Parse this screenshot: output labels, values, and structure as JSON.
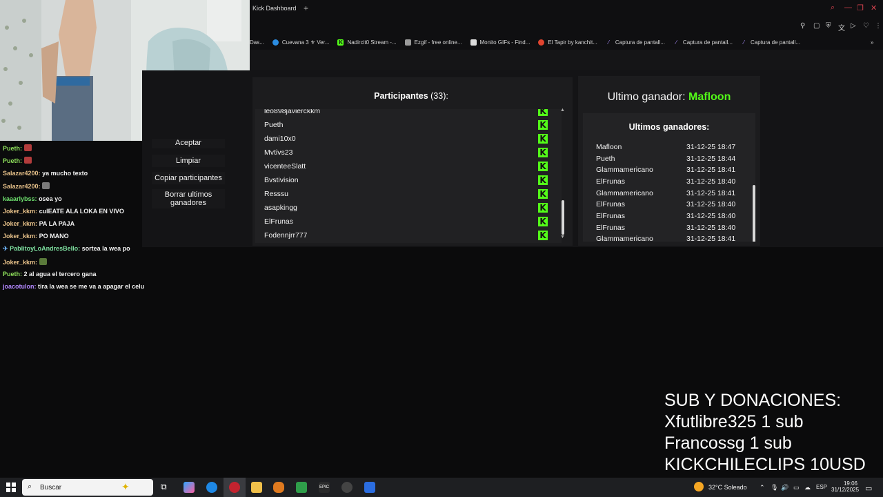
{
  "browser": {
    "tab_title": "Kick Dashboard",
    "new_tab": "+",
    "bookmarks": [
      {
        "label": "Das...",
        "icon": "dashboard-icon",
        "color": "#3b3b3b"
      },
      {
        "label": "Cuevana 3 ⚜ Ver...",
        "icon": "cuevana-icon",
        "color": "#2b8ce0"
      },
      {
        "label": "Nadircit0 Stream -...",
        "icon": "kick-icon",
        "color": "#53fc18"
      },
      {
        "label": "Ezgif - free online...",
        "icon": "ezgif-icon",
        "color": "#9a9a9a"
      },
      {
        "label": "Monito GIFs - Find...",
        "icon": "page-icon",
        "color": "#dddddd"
      },
      {
        "label": "El Tapir by kanchit...",
        "icon": "record-icon",
        "color": "#e0442f"
      },
      {
        "label": "Captura de pantall...",
        "icon": "feather-icon",
        "color": "#a78bfa"
      },
      {
        "label": "Captura de pantall...",
        "icon": "feather-icon",
        "color": "#a78bfa"
      },
      {
        "label": "Captura de pantall...",
        "icon": "feather-icon",
        "color": "#a78bfa"
      }
    ]
  },
  "actions": {
    "accept": "Aceptar",
    "clear": "Limpiar",
    "copy": "Copiar participantes",
    "delete_winners": "Borrar ultimos ganadores"
  },
  "participants": {
    "title": "Participantes",
    "count": "(33):",
    "list": [
      "leo898javierckkm",
      "Pueth",
      "dami10x0",
      "Mvtivs23",
      "vicenteeSlatt",
      "Bvstivision",
      "Resssu",
      "asapkingg",
      "ElFrunas",
      "Fodennjrr777"
    ]
  },
  "winners": {
    "last_label": "Ultimo ganador:",
    "last_name": "Mafloon",
    "list_title": "Ultimos ganadores:",
    "list": [
      {
        "name": "Mafloon",
        "date": "31-12-25 18:47"
      },
      {
        "name": "Pueth",
        "date": "31-12-25 18:44"
      },
      {
        "name": "Glammamericano",
        "date": "31-12-25 18:41"
      },
      {
        "name": "ElFrunas",
        "date": "31-12-25 18:40"
      },
      {
        "name": "Glammamericano",
        "date": "31-12-25 18:41"
      },
      {
        "name": "ElFrunas",
        "date": "31-12-25 18:40"
      },
      {
        "name": "ElFrunas",
        "date": "31-12-25 18:40"
      },
      {
        "name": "ElFrunas",
        "date": "31-12-25 18:40"
      },
      {
        "name": "Glammamericano",
        "date": "31-12-25 18:41"
      }
    ]
  },
  "chat": [
    {
      "user": "Pueth:",
      "text": "",
      "color": "#8fe05c",
      "emote": "#b23c3c"
    },
    {
      "user": "Pueth:",
      "text": "",
      "color": "#8fe05c",
      "emote": "#b23c3c"
    },
    {
      "user": "Salazar4200:",
      "text": "ya mucho texto",
      "color": "#e8c28a"
    },
    {
      "user": "Salazar4200:",
      "text": "",
      "color": "#e8c28a",
      "emote": "#7a7a7a"
    },
    {
      "user": "kaaarlybss:",
      "text": "osea yo",
      "color": "#6ee06e"
    },
    {
      "user": "Joker_kkm:",
      "text": "culEATE ALA LOKA EN VIVO",
      "color": "#e8c28a"
    },
    {
      "user": "Joker_kkm:",
      "text": "PA LA PAJA",
      "color": "#e8c28a"
    },
    {
      "user": "Joker_kkm:",
      "text": "PO MANO",
      "color": "#e8c28a"
    },
    {
      "user": "PablitoyLoAndresBello:",
      "text": "sortea la wea po",
      "color": "#7ee0a0"
    },
    {
      "user": "Joker_kkm:",
      "text": "",
      "color": "#e8c28a",
      "emote": "#5a7a3a"
    },
    {
      "user": "Pueth:",
      "text": "2 al agua el tercero gana",
      "color": "#8fe05c"
    },
    {
      "user": "joacotulon:",
      "text": "tira la wea se me va a apagar el celu",
      "color": "#b388ff"
    }
  ],
  "overlay": {
    "title": "SUB Y DONACIONES:",
    "lines": [
      "Xfutlibre325 1 sub",
      "Francossg 1 sub",
      "KICKCHILECLIPS 10USD"
    ]
  },
  "taskbar": {
    "search_placeholder": "Buscar",
    "weather": "32°C  Soleado",
    "lang": "ESP",
    "time": "19:06",
    "date": "31/12/2025"
  },
  "colors": {
    "kick_green": "#53fc18",
    "accent_red": "#d9434f"
  }
}
